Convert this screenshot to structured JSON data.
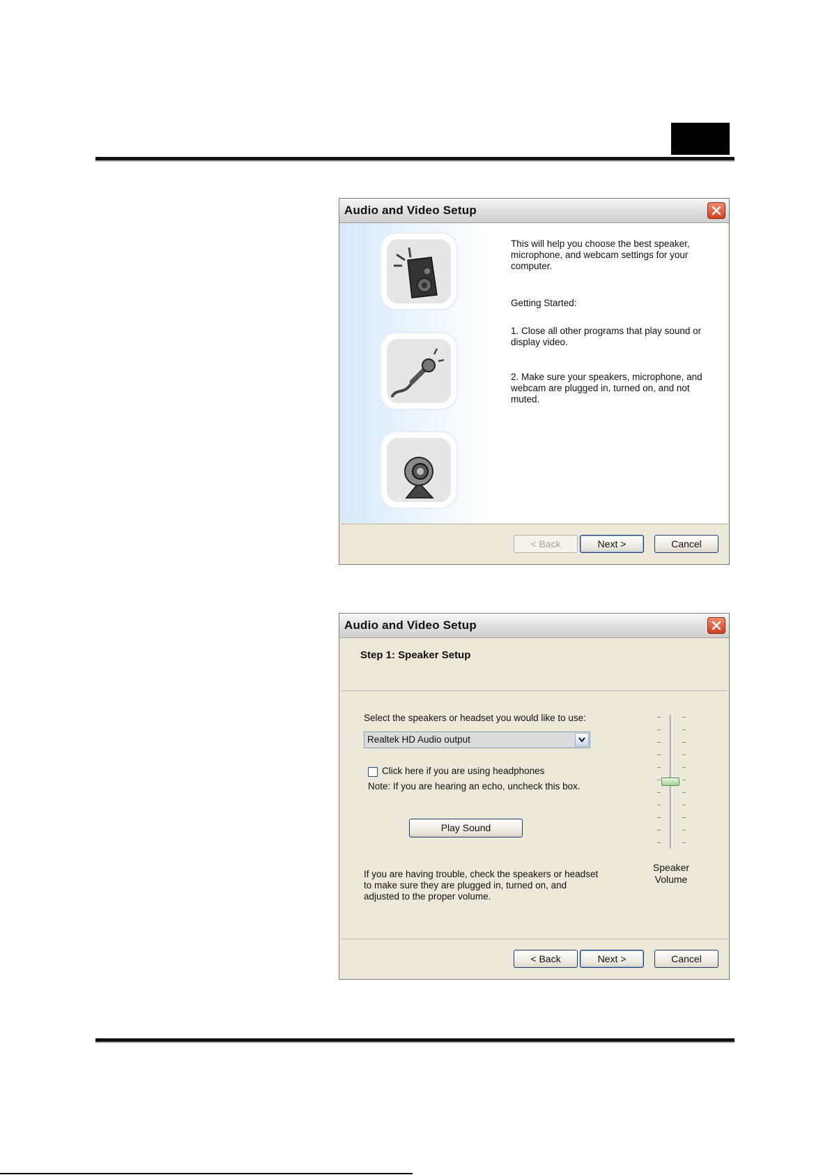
{
  "dialog1": {
    "title": "Audio and Video Setup",
    "intro": "This will help you choose the best speaker, microphone, and webcam settings for your computer.",
    "getting_started": "Getting Started:",
    "step1": "1. Close all other programs that play sound or display video.",
    "step2": "2. Make sure your speakers, microphone, and webcam are plugged in, turned on, and not muted.",
    "icons": [
      "speaker-icon",
      "microphone-icon",
      "webcam-icon"
    ],
    "buttons": {
      "back": "< Back",
      "next": "Next >",
      "cancel": "Cancel"
    }
  },
  "dialog2": {
    "title": "Audio and Video Setup",
    "step_title": "Step 1: Speaker Setup",
    "select_label": "Select the speakers or headset you would like to use:",
    "select_value": "Realtek HD Audio output",
    "checkbox_label": "Click here if you are using headphones",
    "checkbox_checked": false,
    "note": "Note: If you are hearing an echo, uncheck this box.",
    "play_sound": "Play Sound",
    "trouble": "If you are having trouble, check the speakers or headset to make sure they are plugged in, turned on, and adjusted to the proper volume.",
    "volume_label_1": "Speaker",
    "volume_label_2": "Volume",
    "volume_level": 0.5,
    "buttons": {
      "back": "< Back",
      "next": "Next >",
      "cancel": "Cancel"
    }
  },
  "colors": {
    "close_button": "#d9552f",
    "sidebar_gradient": "#d6e9fa",
    "dialog_face": "#ece9d8",
    "slider_thumb": "#9fd592"
  }
}
